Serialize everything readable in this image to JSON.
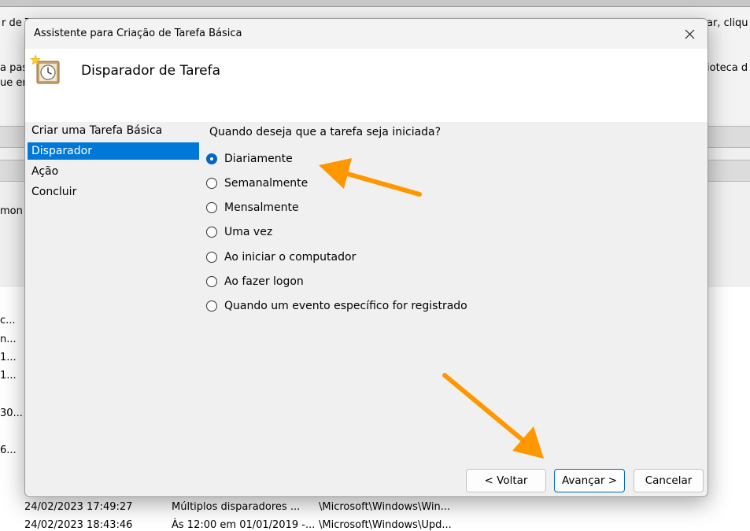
{
  "background": {
    "text_fragments": [
      "r de T",
      "ar, cliqu",
      "a past",
      "ue en",
      "ioteca d",
      "mon",
      "c...",
      "n...",
      "1...",
      "1...",
      "30...",
      "6..."
    ],
    "rows": [
      {
        "date": "24/02/2023 17:49:27",
        "trigger": "Múltiplos disparadores ...",
        "path": "\\Microsoft\\Windows\\Win..."
      },
      {
        "date": "24/02/2023 18:43:46",
        "trigger": "Às 12:00 em 01/01/2019 -...",
        "path": "\\Microsoft\\Windows\\Upd..."
      }
    ]
  },
  "dialog": {
    "title": "Assistente para Criação de Tarefa Básica",
    "header_title": "Disparador de Tarefa",
    "steps": [
      "Criar uma Tarefa Básica",
      "Disparador",
      "Ação",
      "Concluir"
    ],
    "active_step": "Disparador",
    "question": "Quando deseja que a tarefa seja iniciada?",
    "options": [
      {
        "label": "Diariamente",
        "checked": true
      },
      {
        "label": "Semanalmente",
        "checked": false
      },
      {
        "label": "Mensalmente",
        "checked": false
      },
      {
        "label": "Uma vez",
        "checked": false
      },
      {
        "label": "Ao iniciar o computador",
        "checked": false
      },
      {
        "label": "Ao fazer logon",
        "checked": false
      },
      {
        "label": "Quando um evento específico for registrado",
        "checked": false
      }
    ],
    "buttons": {
      "back": "< Voltar",
      "next": "Avançar >",
      "cancel": "Cancelar"
    }
  },
  "colors": {
    "accent": "#0078d7",
    "annotation_arrow": "#ff9800"
  }
}
